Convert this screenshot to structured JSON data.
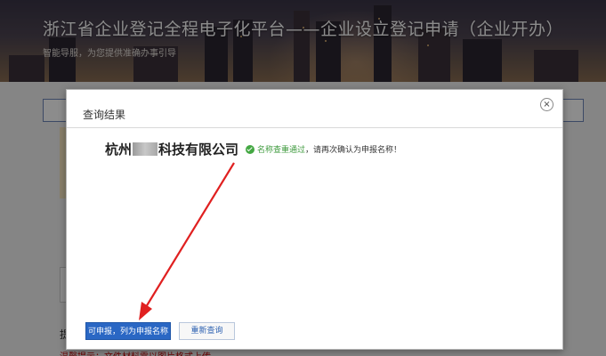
{
  "banner": {
    "title": "浙江省企业登记全程电子化平台——企业设立登记申请（企业开办）",
    "subtitle": "智能导服，为您提供准确办事引导"
  },
  "background_page": {
    "notice_mark": "提",
    "red_tip": "温馨提示：文件材料需以图片格式上传"
  },
  "modal": {
    "title": "查询结果",
    "close_glyph": "×",
    "company": {
      "prefix": "杭州",
      "suffix": "科技有限公司"
    },
    "status": {
      "ok_text": "名称查重通过",
      "rest_text": "，请再次确认为申报名称！"
    },
    "buttons": {
      "confirm_label": "可申报，列为申报名称",
      "requery_label": "重新查询"
    }
  },
  "colors": {
    "primary": "#2a67c4",
    "success": "#44a843",
    "annotation_arrow": "#e02020"
  }
}
